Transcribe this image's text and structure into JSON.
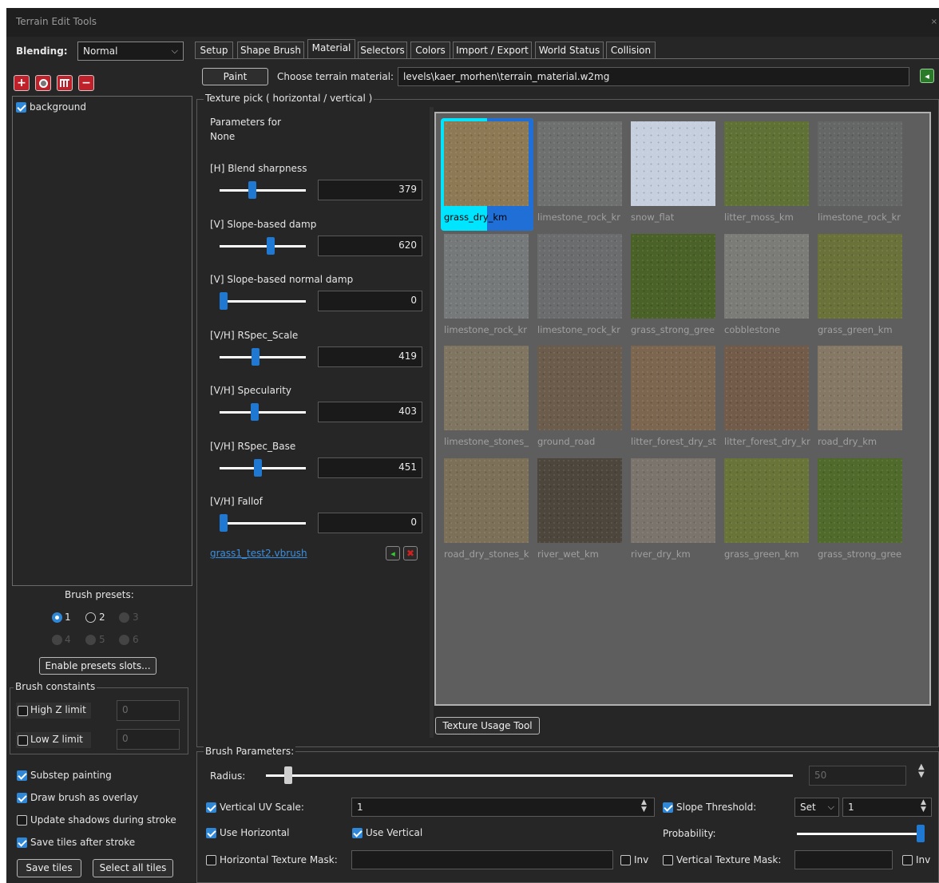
{
  "window": {
    "title": "Terrain Edit Tools",
    "close_glyph": "×"
  },
  "left": {
    "blending_label": "Blending:",
    "blending_value": "Normal",
    "layers": [
      {
        "label": "background",
        "checked": true
      }
    ],
    "brush_presets_label": "Brush presets:",
    "presets": [
      "1",
      "2",
      "3",
      "4",
      "5",
      "6"
    ],
    "enable_presets_label": "Enable presets slots...",
    "brush_constraints": {
      "title": "Brush constaints",
      "high_z_label": "High Z limit",
      "high_z_value": "0",
      "low_z_label": "Low Z limit",
      "low_z_value": "0"
    },
    "options": {
      "substep": "Substep painting",
      "draw_overlay": "Draw brush as overlay",
      "update_shadows": "Update shadows during stroke",
      "save_tiles_after": "Save tiles after stroke"
    },
    "save_tiles_label": "Save tiles",
    "select_all_tiles_label": "Select all tiles"
  },
  "tabs": [
    "Setup",
    "Shape Brush",
    "Material",
    "Selectors",
    "Colors",
    "Import / Export",
    "World Status",
    "Collision"
  ],
  "material": {
    "paint_label": "Paint",
    "choose_label": "Choose terrain material:",
    "material_path": "levels\\kaer_morhen\\terrain_material.w2mg"
  },
  "texture_pick": {
    "title": "Texture pick ( horizontal / vertical )",
    "params_for": "Parameters for",
    "params_target": "None",
    "params": [
      {
        "label": "[H] Blend sharpness",
        "value": "379",
        "level": 0.37
      },
      {
        "label": "[V] Slope-based damp",
        "value": "620",
        "level": 0.6
      },
      {
        "label": "[V] Slope-based normal damp",
        "value": "0",
        "level": 0.0
      },
      {
        "label": "[V/H] RSpec_Scale",
        "value": "419",
        "level": 0.41
      },
      {
        "label": "[V/H] Specularity",
        "value": "403",
        "level": 0.4
      },
      {
        "label": "[V/H] RSpec_Base",
        "value": "451",
        "level": 0.44
      },
      {
        "label": "[V/H] Fallof",
        "value": "0",
        "level": 0.0
      }
    ],
    "brush_file": "grass1_test2.vbrush",
    "texture_usage_label": "Texture Usage Tool",
    "textures": [
      {
        "name": "grass_dry_km",
        "color": "#8d7a55",
        "selected": true
      },
      {
        "name": "limestone_rock_kr",
        "color": "#6e6f6f"
      },
      {
        "name": "snow_flat",
        "color": "#c5cfdd"
      },
      {
        "name": "litter_moss_km",
        "color": "#5f7134"
      },
      {
        "name": "limestone_rock_kr",
        "color": "#646766"
      },
      {
        "name": "limestone_rock_kr",
        "color": "#76797a"
      },
      {
        "name": "limestone_rock_kr",
        "color": "#6a6c6d"
      },
      {
        "name": "grass_strong_gree",
        "color": "#4a6128"
      },
      {
        "name": "cobblestone",
        "color": "#7b7c78"
      },
      {
        "name": "grass_green_km",
        "color": "#6a7139"
      },
      {
        "name": "limestone_stones_",
        "color": "#7f7560"
      },
      {
        "name": "ground_road",
        "color": "#6c5c4b"
      },
      {
        "name": "litter_forest_dry_st",
        "color": "#7d6650"
      },
      {
        "name": "litter_forest_dry_kr",
        "color": "#735b49"
      },
      {
        "name": "road_dry_km",
        "color": "#857865"
      },
      {
        "name": "road_dry_stones_k",
        "color": "#7c7058"
      },
      {
        "name": "river_wet_km",
        "color": "#4d463d"
      },
      {
        "name": "river_dry_km",
        "color": "#7a746d"
      },
      {
        "name": "grass_green_km",
        "color": "#687438"
      },
      {
        "name": "grass_strong_gree",
        "color": "#4f6a2a"
      }
    ]
  },
  "brush_params": {
    "title": "Brush Parameters:",
    "radius_label": "Radius:",
    "radius_value": "50",
    "radius_level": 0.02,
    "vertical_uv_label": "Vertical UV Scale:",
    "vertical_uv_value": "1",
    "slope_threshold_label": "Slope Threshold:",
    "slope_mode": "Set",
    "slope_value": "1",
    "use_horizontal_label": "Use Horizontal",
    "use_vertical_label": "Use Vertical",
    "probability_label": "Probability:",
    "probability_level": 1.0,
    "h_mask_label": "Horizontal Texture Mask:",
    "inv_label": "Inv",
    "v_mask_label": "Vertical Texture Mask:"
  },
  "colors": {
    "accent": "#2f87d8",
    "window_bg": "#262626",
    "grid_bg": "#5a5a5a",
    "selection": "#00e5ff"
  },
  "icons": [
    "add-layer-icon",
    "circle-brush-icon",
    "grid-icon",
    "remove-layer-icon",
    "green-arrow-icon",
    "red-delete-icon",
    "chevron-down-icon",
    "spinner-arrows-icon"
  ]
}
